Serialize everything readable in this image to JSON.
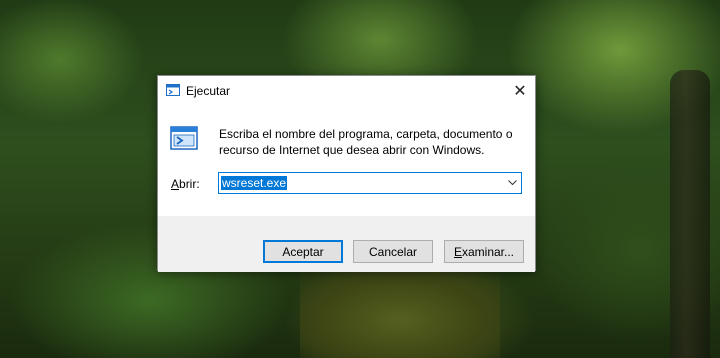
{
  "window": {
    "title": "Ejecutar",
    "close_glyph": "✕"
  },
  "prompt": {
    "line1": "Escriba el nombre del programa, carpeta, documento o",
    "line2": "recurso de Internet que desea abrir con Windows."
  },
  "open_field": {
    "label_underlined": "A",
    "label_rest": "brir:",
    "value": "wsreset.exe"
  },
  "buttons": {
    "accept": "Aceptar",
    "cancel": "Cancelar",
    "browse_underlined": "E",
    "browse_rest": "xaminar..."
  },
  "icons": {
    "title": "run-icon",
    "main": "run-icon",
    "dropdown": "chevron-down-icon",
    "close": "close-icon"
  },
  "colors": {
    "accent": "#0078d7",
    "selection": "#0078d7",
    "dialog_bg": "#f0f0f0"
  }
}
